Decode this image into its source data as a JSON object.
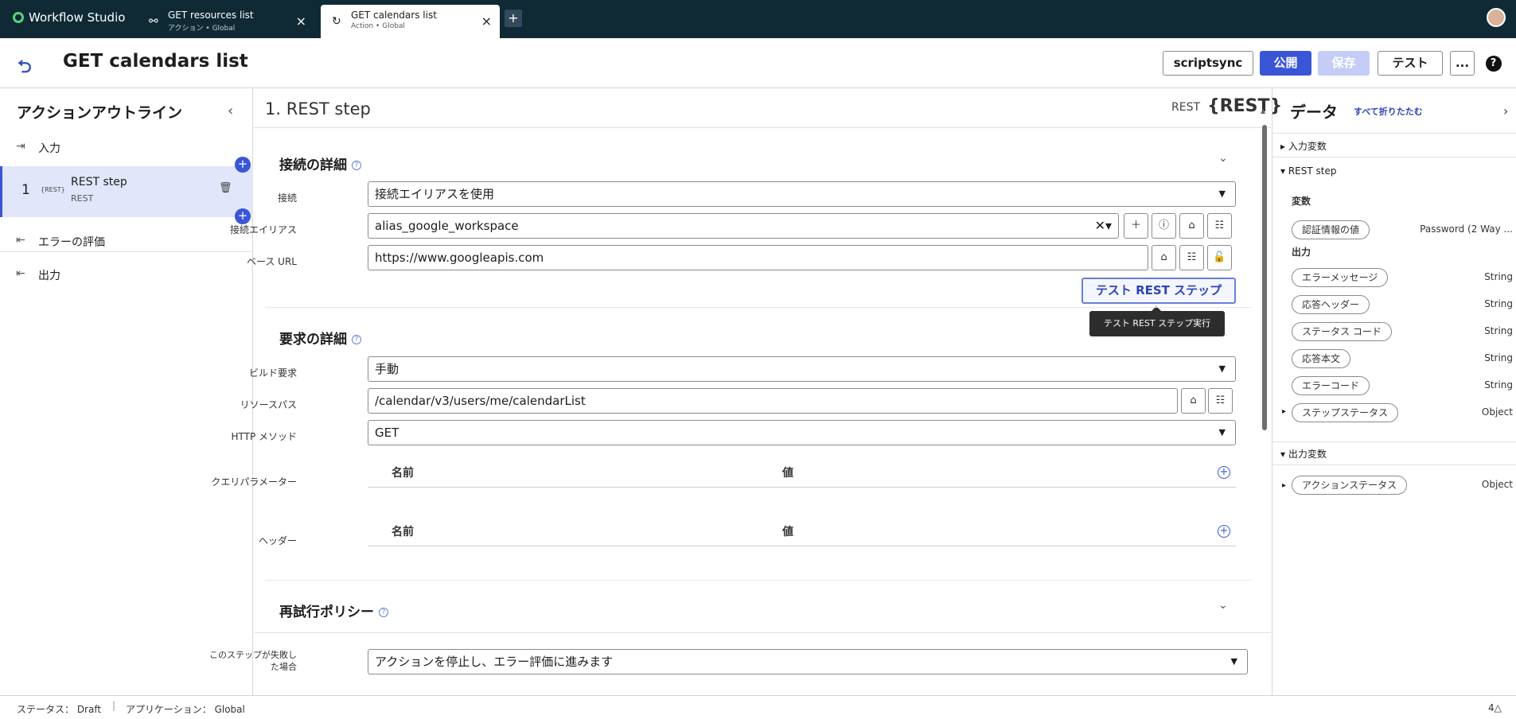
{
  "topbar": {
    "app_name": "Workflow Studio",
    "tabs": [
      {
        "title": "GET resources list",
        "subtitle": "アクション • Global"
      },
      {
        "title": "GET calendars list",
        "subtitle": "Action • Global"
      }
    ],
    "add_tab": "+"
  },
  "header": {
    "title": "GET calendars list",
    "buttons": {
      "scriptsync": "scriptsync",
      "publish": "公開",
      "save": "保存",
      "test": "テスト",
      "more": "...",
      "help": "?"
    }
  },
  "outline": {
    "title": "アクションアウトライン",
    "input": "入力",
    "step_number": "1",
    "step_badge": "{REST}",
    "step_name": "REST step",
    "step_type": "REST",
    "error_eval": "エラーの評価",
    "output": "出力"
  },
  "step": {
    "title": "1.  REST step",
    "type": "REST",
    "badge": "{REST}",
    "connection_section": "接続の詳細",
    "connection_label": "接続",
    "connection_value": "接続エイリアスを使用",
    "alias_label": "接続エイリアス",
    "alias_value": "alias_google_workspace",
    "base_url_label": "ベース URL",
    "base_url_value": "https://www.googleapis.com",
    "test_button": "テスト REST ステップ",
    "tooltip": "テスト REST ステップ実行",
    "request_section": "要求の詳細",
    "build_label": "ビルド要求",
    "build_value": "手動",
    "resource_label": "リソースパス",
    "resource_value": "/calendar/v3/users/me/calendarList",
    "method_label": "HTTP メソッド",
    "method_value": "GET",
    "query_label": "クエリパラメーター",
    "header_label": "ヘッダー",
    "col_name": "名前",
    "col_value": "値",
    "retry_section": "再試行ポリシー",
    "fail_label_1": "このステップが失敗し",
    "fail_label_2": "た場合",
    "fail_value": "アクションを停止し、エラー評価に進みます"
  },
  "data_panel": {
    "title": "データ",
    "collapse_all": "すべて折りたたむ",
    "input_vars": "入力変数",
    "rest_step": "REST step",
    "variables": "変数",
    "cred_pill": "認証情報の値",
    "cred_type": "Password (2 Way ...",
    "outputs": "出力",
    "items": [
      {
        "name": "エラーメッセージ",
        "type": "String"
      },
      {
        "name": "応答ヘッダー",
        "type": "String"
      },
      {
        "name": "ステータス コード",
        "type": "String"
      },
      {
        "name": "応答本文",
        "type": "String"
      },
      {
        "name": "エラーコード",
        "type": "String"
      },
      {
        "name": "ステップステータス",
        "type": "Object"
      }
    ],
    "output_vars": "出力変数",
    "action_status": "アクションステータス",
    "action_status_type": "Object"
  },
  "statusbar": {
    "status": "ステータス： Draft",
    "application": "アプリケーション： Global",
    "notifications": "4"
  },
  "colors": {
    "topbar": "#0f2a35",
    "accent": "#3a55d6",
    "selected": "#e1e6fb"
  }
}
